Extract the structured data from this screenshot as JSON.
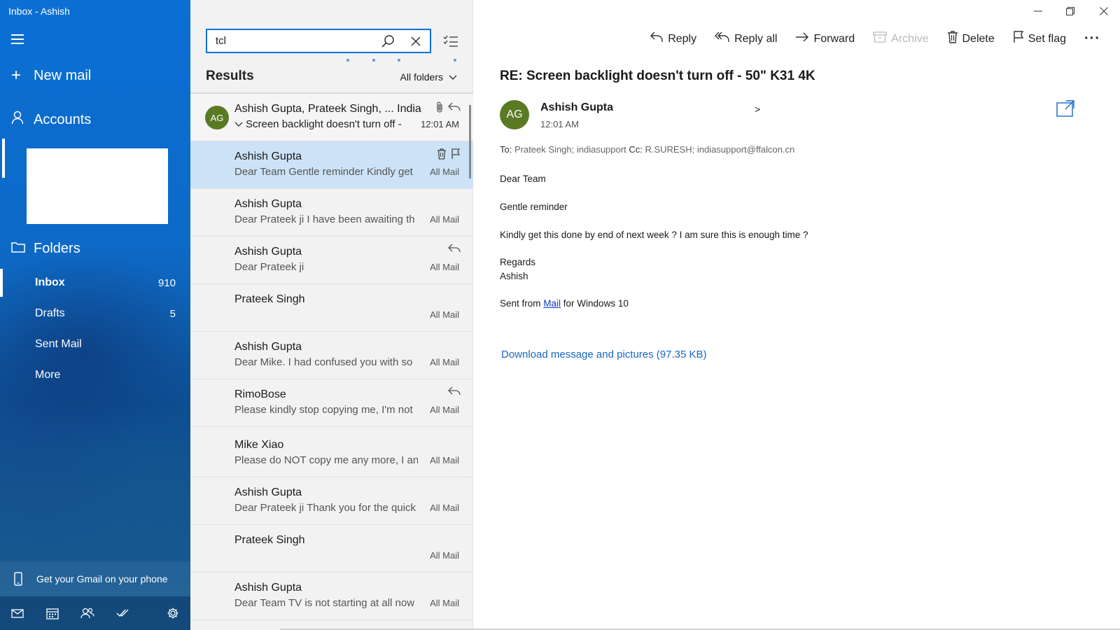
{
  "window": {
    "title": "Inbox - Ashish"
  },
  "nav": {
    "new_mail_label": "New mail",
    "accounts_label": "Accounts",
    "folders_label": "Folders",
    "folders": [
      {
        "name": "Inbox",
        "count": "910",
        "active": true
      },
      {
        "name": "Drafts",
        "count": "5",
        "active": false
      },
      {
        "name": "Sent Mail",
        "count": "",
        "active": false
      },
      {
        "name": "More",
        "count": "",
        "active": false
      }
    ],
    "gmail_promo": "Get your Gmail on your phone"
  },
  "search": {
    "value": "tcl"
  },
  "list": {
    "results_label": "Results",
    "scope_label": "All folders",
    "messages": [
      {
        "sender": "Ashish Gupta, Prateek Singh, ... India",
        "preview": "Screen backlight doesn't turn off - ",
        "time": "12:01 AM",
        "avatar": "AG"
      },
      {
        "sender": "Ashish Gupta",
        "preview": "Dear Team Gentle reminder Kindly get",
        "folder": "All Mail"
      },
      {
        "sender": "Ashish Gupta",
        "preview": "Dear Prateek ji I have been awaiting th",
        "folder": "All Mail"
      },
      {
        "sender": "Ashish Gupta",
        "preview": "Dear Prateek ji",
        "folder": "All Mail"
      },
      {
        "sender": "Prateek Singh",
        "preview": "",
        "folder": "All Mail"
      },
      {
        "sender": "Ashish Gupta",
        "preview": "Dear Mike. I had confused you with so",
        "folder": "All Mail"
      },
      {
        "sender": "RimoBose",
        "preview": "Please kindly stop copying me, I'm not",
        "folder": "All Mail"
      },
      {
        "sender": "Mike Xiao",
        "preview": "Please do NOT copy me any more, I an",
        "folder": "All Mail"
      },
      {
        "sender": "Ashish Gupta",
        "preview": "Dear Prateek ji Thank you for the quick",
        "folder": "All Mail"
      },
      {
        "sender": "Prateek Singh",
        "preview": "",
        "folder": "All Mail"
      },
      {
        "sender": "Ashish Gupta",
        "preview": "Dear Team TV is not starting at all now",
        "folder": "All Mail"
      }
    ]
  },
  "toolbar": {
    "reply": "Reply",
    "reply_all": "Reply all",
    "forward": "Forward",
    "archive": "Archive",
    "delete": "Delete",
    "set_flag": "Set flag",
    "more": "···"
  },
  "reader": {
    "subject": "RE: Screen backlight doesn't turn off - 50\" K31 4K",
    "avatar": "AG",
    "sender": "Ashish Gupta",
    "time": "12:01 AM",
    "expand": ">",
    "to_label": "To:",
    "to": "Prateek Singh; indiasupport",
    "cc_label": "Cc:",
    "cc": "R.SURESH; indiasupport@ffalcon.cn",
    "body": {
      "greeting": "Dear Team",
      "line1": "Gentle reminder",
      "line2": "Kindly get this done by end of next week ? I am sure this is enough time ?",
      "regards": "Regards",
      "name": "Ashish",
      "sent_prefix": "Sent from ",
      "sent_link": "Mail",
      "sent_suffix": " for Windows 10"
    },
    "download_link": "Download message and pictures (97.35 KB)"
  },
  "colors": {
    "accent": "#0b6fd4",
    "selected_row": "#cce3f7",
    "avatar": "#5a7a24",
    "link": "#1766c4"
  }
}
